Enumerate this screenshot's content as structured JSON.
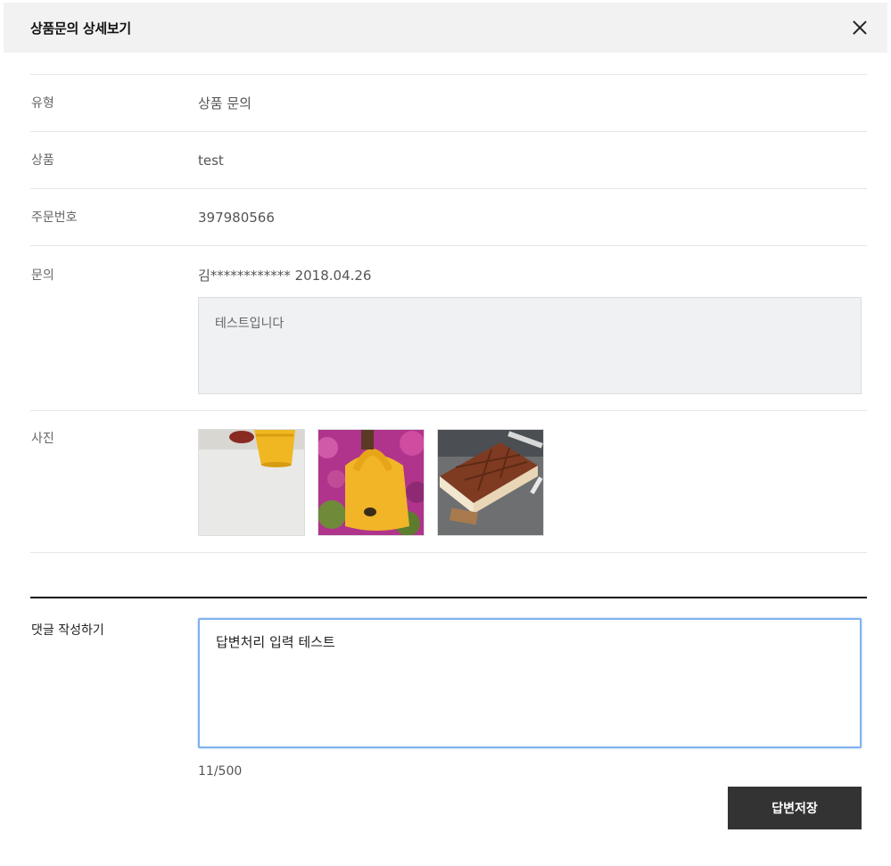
{
  "modal": {
    "title": "상품문의 상세보기"
  },
  "details": {
    "type_label": "유형",
    "type_value": "상품 문의",
    "product_label": "상품",
    "product_value": "test",
    "order_label": "주문번호",
    "order_value": "397980566",
    "inquiry_label": "문의",
    "inquiry_author": "김************",
    "inquiry_date": "2018.04.26",
    "inquiry_content": "테스트입니다",
    "photos_label": "사진"
  },
  "reply": {
    "label": "댓글 작성하기",
    "value": "답변처리 입력 테스트",
    "counter": "11/500",
    "save_label": "답변저장"
  },
  "colors": {
    "header_bg": "#f2f2f2",
    "button_bg": "#333333",
    "focus_border": "#7fb3ef"
  }
}
